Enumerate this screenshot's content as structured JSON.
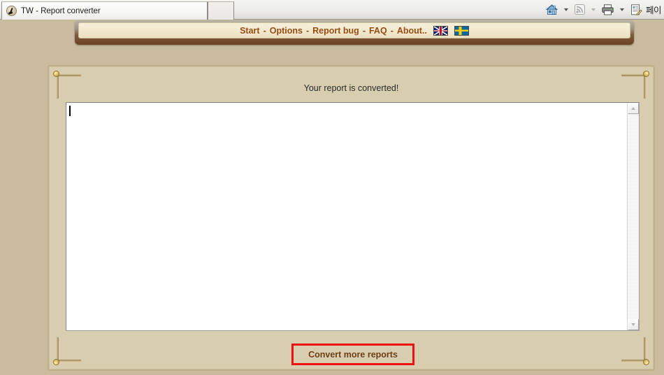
{
  "browser": {
    "tabs": [
      {
        "title": "TW - Report converter",
        "favicon": "tw-globe-icon",
        "active": true
      },
      {
        "title": "",
        "favicon": "",
        "active": false
      }
    ],
    "toolbar": {
      "home_icon": "home-icon",
      "feed_icon": "rss-feed-icon",
      "print_icon": "printer-icon",
      "page_icon": "page-edit-icon",
      "page_label": "페이"
    }
  },
  "nav": {
    "items": [
      {
        "label": "Start"
      },
      {
        "label": "Options"
      },
      {
        "label": "Report bug"
      },
      {
        "label": "FAQ"
      },
      {
        "label": "About.."
      }
    ],
    "separator": "-",
    "flags": [
      {
        "name": "flag-uk",
        "title": "English"
      },
      {
        "name": "flag-sweden",
        "title": "Svenska"
      }
    ],
    "link_color": "#9c4a0c"
  },
  "main": {
    "status_heading": "Your report is converted!",
    "output": {
      "value": "",
      "placeholder": "",
      "scrollbar": {
        "up": "scroll-up-arrow",
        "down": "scroll-down-arrow",
        "enabled": false
      }
    },
    "convert_button": {
      "label": "Convert more reports",
      "border_color": "#ee1111",
      "text_color": "#6b3b0c"
    }
  },
  "theme": {
    "page_background": "#c9bc9e",
    "panel_background": "#d9cdaf",
    "menu_background": "#f2e9cf",
    "accent": "#9c4a0c"
  }
}
